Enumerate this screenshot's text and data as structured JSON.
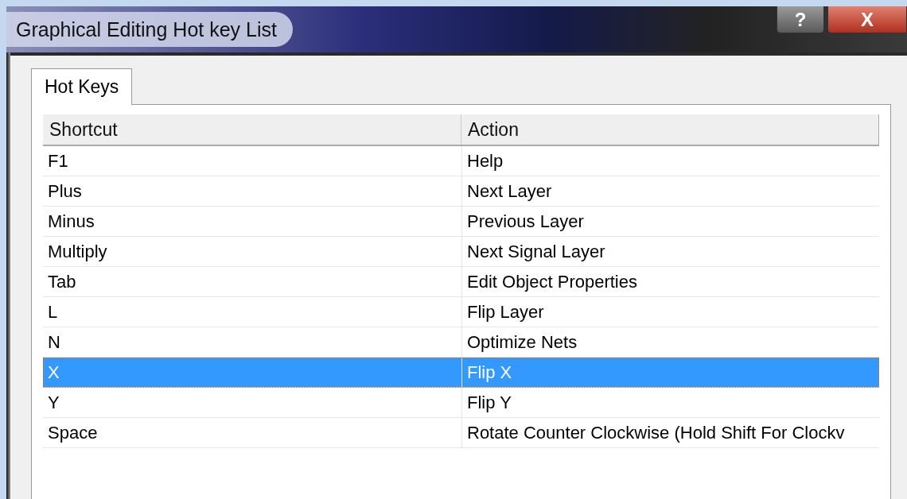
{
  "window": {
    "title": "Graphical Editing Hot key List",
    "help_button": "?",
    "close_button": "X"
  },
  "tabs": [
    {
      "label": "Hot Keys",
      "selected": true
    }
  ],
  "table": {
    "columns": [
      "Shortcut",
      "Action"
    ],
    "rows": [
      {
        "shortcut": "F1",
        "action": "Help",
        "selected": false
      },
      {
        "shortcut": "Plus",
        "action": "Next Layer",
        "selected": false
      },
      {
        "shortcut": "Minus",
        "action": "Previous Layer",
        "selected": false
      },
      {
        "shortcut": "Multiply",
        "action": "Next Signal Layer",
        "selected": false
      },
      {
        "shortcut": "Tab",
        "action": "Edit Object Properties",
        "selected": false
      },
      {
        "shortcut": "L",
        "action": "Flip Layer",
        "selected": false
      },
      {
        "shortcut": "N",
        "action": "Optimize Nets",
        "selected": false
      },
      {
        "shortcut": "X",
        "action": "Flip X",
        "selected": true
      },
      {
        "shortcut": "Y",
        "action": "Flip Y",
        "selected": false
      },
      {
        "shortcut": "Space",
        "action": "Rotate Counter Clockwise (Hold Shift For Clockv",
        "selected": false
      }
    ]
  }
}
